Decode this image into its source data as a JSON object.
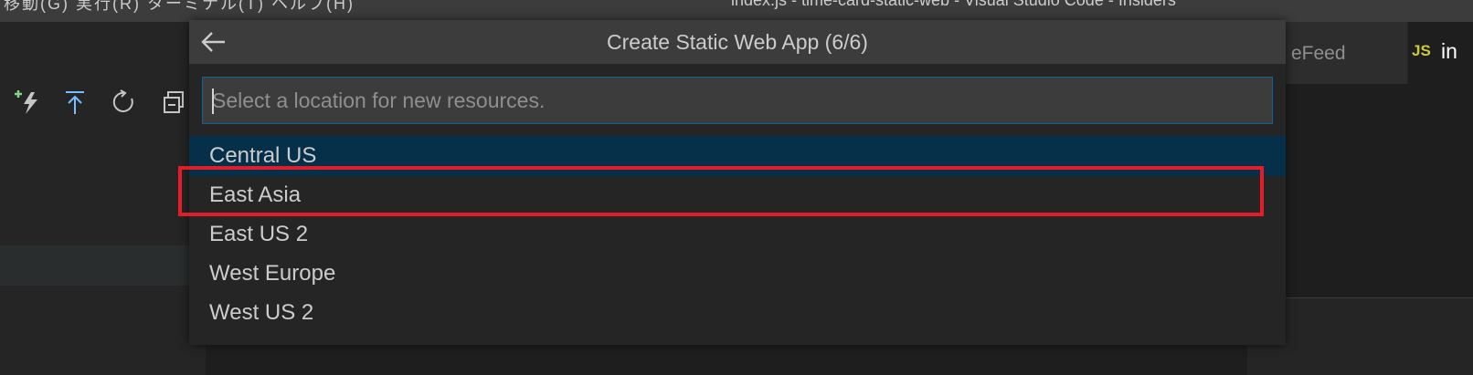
{
  "window": {
    "menu_text": "移動(G)   実行(R)   ターミナル(T)   ヘルプ(H)",
    "title": "index.js - time-card-static-web - Visual Studio Code - Insiders"
  },
  "sidebar": {
    "toolbar_icons": [
      "lightning-plus-icon",
      "deploy-arrow-up-icon",
      "refresh-icon",
      "collapse-all-icon"
    ]
  },
  "editor": {
    "tabs": [
      {
        "label": "eFeed",
        "active": false
      },
      {
        "badge": "JS",
        "label": "in",
        "active": true
      }
    ]
  },
  "quick_pick": {
    "title": "Create Static Web App (6/6)",
    "placeholder": "Select a location for new resources.",
    "items": [
      "Central US",
      "East Asia",
      "East US 2",
      "West Europe",
      "West US 2"
    ],
    "focused_index": 0,
    "highlighted_index": 1
  },
  "colors": {
    "focused_item": "#062f4a",
    "highlight_box": "#e11d2a",
    "input_border": "#0e639c"
  }
}
